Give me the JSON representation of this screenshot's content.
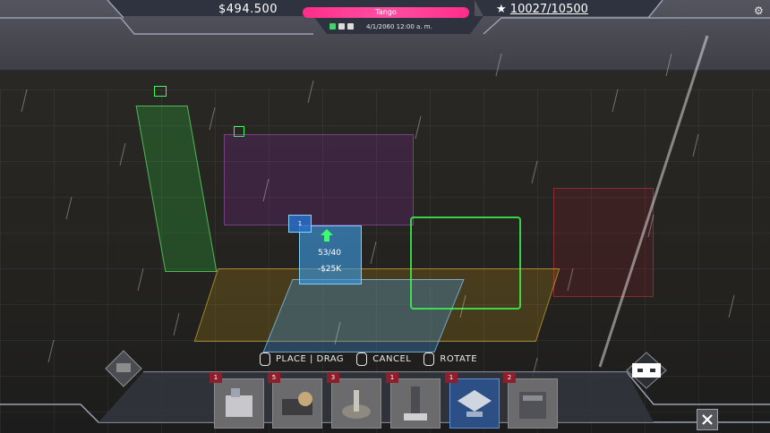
{
  "hud": {
    "money": "$494.500",
    "profile_name": "Tango",
    "datetime": "4/1/2060 12:00 a. m.",
    "rating": "10027/10500",
    "speed_buttons": [
      "play",
      "fast",
      "fastest"
    ]
  },
  "tooltip": {
    "badge": "1",
    "capacity": "53/40",
    "cost": "-$25K"
  },
  "hints": {
    "place": "PLACE | DRAG",
    "cancel": "CANCEL",
    "rotate": "ROTATE"
  },
  "toolbar": {
    "slots": [
      {
        "count": "1",
        "selected": false
      },
      {
        "count": "5",
        "selected": false
      },
      {
        "count": "3",
        "selected": false
      },
      {
        "count": "1",
        "selected": false
      },
      {
        "count": "1",
        "selected": true
      },
      {
        "count": "2",
        "selected": false
      }
    ]
  },
  "colors": {
    "profile_bar": "#ff2d8a",
    "selected_slot": "#2c4f86",
    "count_badge": "#8c1f2b"
  }
}
